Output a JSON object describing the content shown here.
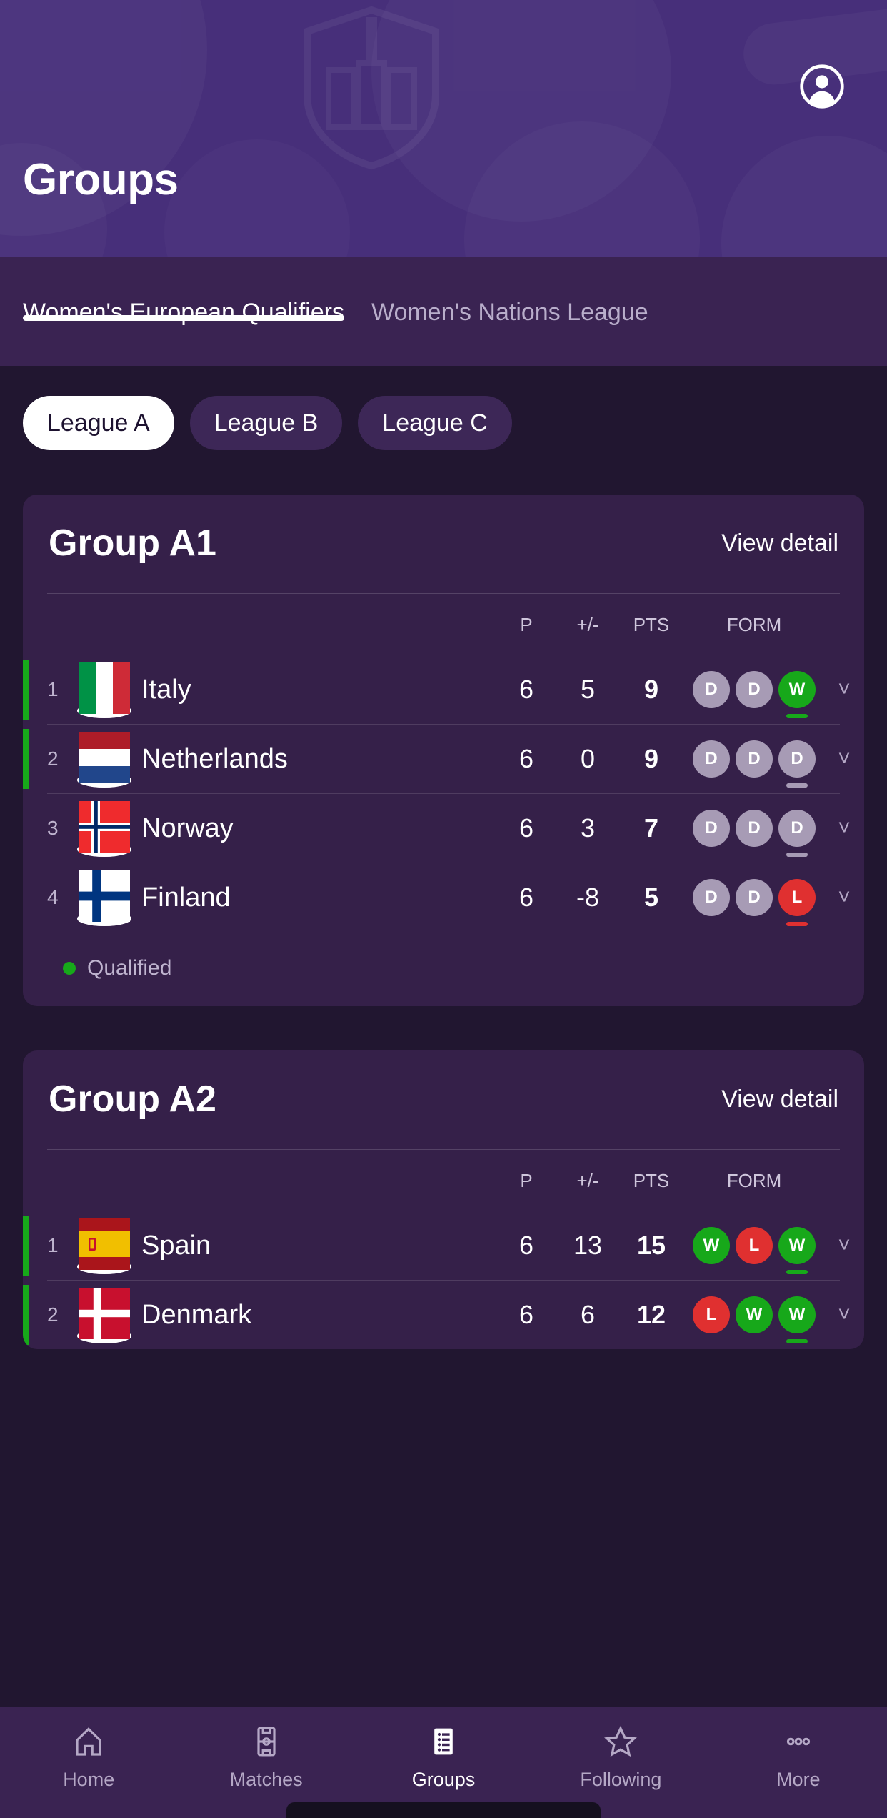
{
  "header": {
    "title": "Groups",
    "profile_icon": "account-circle-icon"
  },
  "tabs": [
    {
      "label": "Women's European Qualifiers",
      "active": true
    },
    {
      "label": "Women's Nations League",
      "active": false
    }
  ],
  "league_chips": [
    {
      "label": "League A",
      "selected": true
    },
    {
      "label": "League B",
      "selected": false
    },
    {
      "label": "League C",
      "selected": false
    }
  ],
  "columns": {
    "rank": "",
    "team": "",
    "p": "P",
    "gd": "+/-",
    "pts": "PTS",
    "form": "FORM"
  },
  "view_detail_label": "View detail",
  "legend": {
    "dot_color": "#17a81a",
    "label": "Qualified"
  },
  "colors": {
    "header_purple": "#472f7a",
    "tabbar_purple": "#3a2352",
    "page_bg": "#211630",
    "card_bg": "#352049",
    "win_green": "#17a81a",
    "loss_red": "#e03030",
    "draw_grey": "#a79bb5",
    "chip_selected_bg": "#ffffff",
    "chip_unselected_bg": "#3d2757"
  },
  "groups": [
    {
      "title": "Group A1",
      "rows": [
        {
          "rank": "1",
          "team": "Italy",
          "p": "6",
          "gd": "5",
          "pts": "9",
          "form": [
            "D",
            "D",
            "W"
          ],
          "last_result": "W",
          "qualified": true,
          "flag": "italy"
        },
        {
          "rank": "2",
          "team": "Netherlands",
          "p": "6",
          "gd": "0",
          "pts": "9",
          "form": [
            "D",
            "D",
            "D"
          ],
          "last_result": "D",
          "qualified": true,
          "flag": "netherlands"
        },
        {
          "rank": "3",
          "team": "Norway",
          "p": "6",
          "gd": "3",
          "pts": "7",
          "form": [
            "D",
            "D",
            "D"
          ],
          "last_result": "D",
          "qualified": false,
          "flag": "norway"
        },
        {
          "rank": "4",
          "team": "Finland",
          "p": "6",
          "gd": "-8",
          "pts": "5",
          "form": [
            "D",
            "D",
            "L"
          ],
          "last_result": "L",
          "qualified": false,
          "flag": "finland"
        }
      ],
      "show_legend": true
    },
    {
      "title": "Group A2",
      "rows": [
        {
          "rank": "1",
          "team": "Spain",
          "p": "6",
          "gd": "13",
          "pts": "15",
          "form": [
            "W",
            "L",
            "W"
          ],
          "last_result": "W",
          "qualified": true,
          "flag": "spain"
        },
        {
          "rank": "2",
          "team": "Denmark",
          "p": "6",
          "gd": "6",
          "pts": "12",
          "form": [
            "L",
            "W",
            "W"
          ],
          "last_result": "W",
          "qualified": true,
          "flag": "denmark"
        }
      ],
      "show_legend": false
    }
  ],
  "bottom_nav": [
    {
      "label": "Home",
      "icon": "home-icon",
      "active": false
    },
    {
      "label": "Matches",
      "icon": "pitch-icon",
      "active": false
    },
    {
      "label": "Groups",
      "icon": "list-icon",
      "active": true
    },
    {
      "label": "Following",
      "icon": "star-icon",
      "active": false
    },
    {
      "label": "More",
      "icon": "ellipsis-icon",
      "active": false
    }
  ]
}
